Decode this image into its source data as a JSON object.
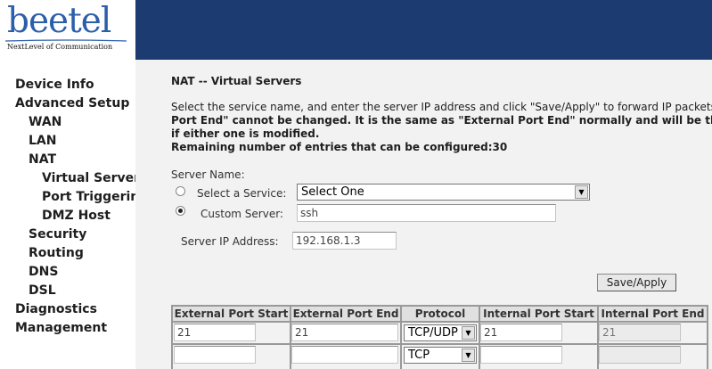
{
  "brand": {
    "logo_text": "beetel",
    "tagline": "NextLevel of Communication",
    "colors": {
      "logo_blue": "#2c5faa",
      "banner_blue": "#1c3b70",
      "content_bg": "#f2f2f2"
    }
  },
  "sidebar": {
    "items": [
      {
        "label": "Device Info"
      },
      {
        "label": "Advanced Setup"
      },
      {
        "label": "WAN"
      },
      {
        "label": "LAN"
      },
      {
        "label": "NAT"
      },
      {
        "label": "Virtual Servers"
      },
      {
        "label": "Port Triggering"
      },
      {
        "label": "DMZ Host"
      },
      {
        "label": "Security"
      },
      {
        "label": "Routing"
      },
      {
        "label": "DNS"
      },
      {
        "label": "DSL"
      },
      {
        "label": "Diagnostics"
      },
      {
        "label": "Management"
      }
    ]
  },
  "main": {
    "title": "NAT -- Virtual Servers",
    "description": {
      "line1": "Select the service name, and enter the server IP address and click \"Save/Apply\" to forward IP packets for this service to the specified server.",
      "line2": "Port End\" cannot be changed. It is the same as \"External Port End\" normally and will be the same as the \"Internal Port Start\" or \"External Port End\"",
      "line3": "if either one is modified.",
      "line4": "Remaining number of entries that can be configured:30"
    },
    "server_name_label": "Server Name:",
    "select_service_label": "Select a Service:",
    "service_select_value": "Select One",
    "custom_server_label": "Custom Server:",
    "custom_server_value": "ssh",
    "server_ip_label": "Server IP Address:",
    "server_ip_value": "192.168.1.3",
    "save_label": "Save/Apply",
    "table": {
      "headers": [
        "External Port Start",
        "External Port End",
        "Protocol",
        "Internal Port Start",
        "Internal Port End"
      ],
      "rows": [
        {
          "ext_start": "21",
          "ext_end": "21",
          "protocol": "TCP/UDP",
          "int_start": "21",
          "int_end": "21"
        },
        {
          "ext_start": "",
          "ext_end": "",
          "protocol": "TCP",
          "int_start": "",
          "int_end": ""
        }
      ]
    }
  }
}
